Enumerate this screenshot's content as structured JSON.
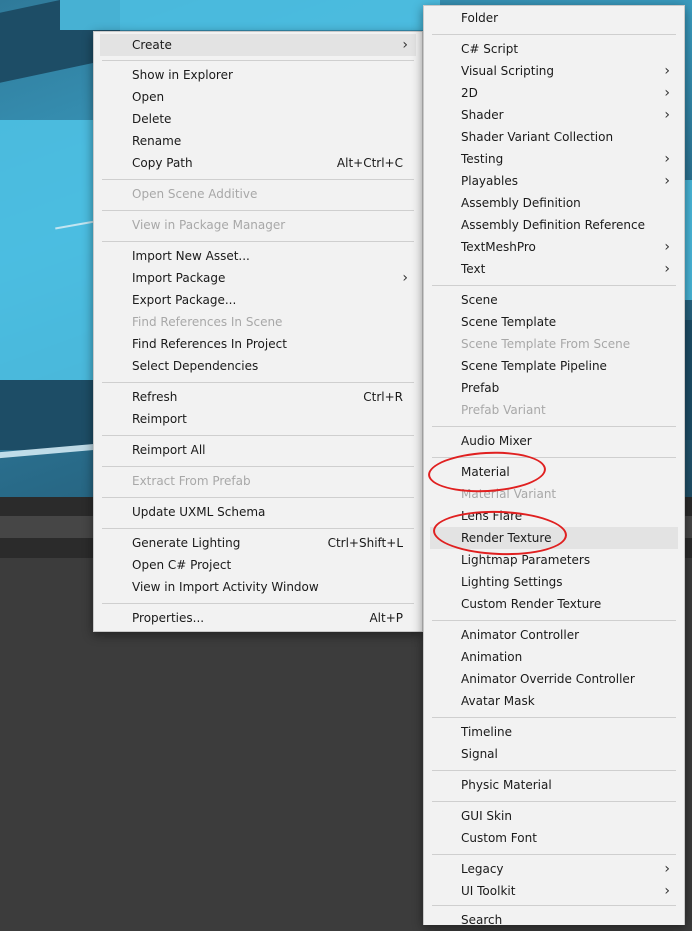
{
  "main_menu": {
    "items": [
      {
        "label": "Create",
        "shortcut": "",
        "submenu": true,
        "disabled": false,
        "highlighted": true
      },
      {
        "label": "Show in Explorer",
        "shortcut": "",
        "submenu": false,
        "disabled": false
      },
      {
        "label": "Open",
        "shortcut": "",
        "submenu": false,
        "disabled": false
      },
      {
        "label": "Delete",
        "shortcut": "",
        "submenu": false,
        "disabled": false
      },
      {
        "label": "Rename",
        "shortcut": "",
        "submenu": false,
        "disabled": false
      },
      {
        "label": "Copy Path",
        "shortcut": "Alt+Ctrl+C",
        "submenu": false,
        "disabled": false
      },
      {
        "label": "Open Scene Additive",
        "shortcut": "",
        "submenu": false,
        "disabled": true
      },
      {
        "label": "View in Package Manager",
        "shortcut": "",
        "submenu": false,
        "disabled": true
      },
      {
        "label": "Import New Asset...",
        "shortcut": "",
        "submenu": false,
        "disabled": false
      },
      {
        "label": "Import Package",
        "shortcut": "",
        "submenu": true,
        "disabled": false
      },
      {
        "label": "Export Package...",
        "shortcut": "",
        "submenu": false,
        "disabled": false
      },
      {
        "label": "Find References In Scene",
        "shortcut": "",
        "submenu": false,
        "disabled": true
      },
      {
        "label": "Find References In Project",
        "shortcut": "",
        "submenu": false,
        "disabled": false
      },
      {
        "label": "Select Dependencies",
        "shortcut": "",
        "submenu": false,
        "disabled": false
      },
      {
        "label": "Refresh",
        "shortcut": "Ctrl+R",
        "submenu": false,
        "disabled": false
      },
      {
        "label": "Reimport",
        "shortcut": "",
        "submenu": false,
        "disabled": false
      },
      {
        "label": "Reimport All",
        "shortcut": "",
        "submenu": false,
        "disabled": false
      },
      {
        "label": "Extract From Prefab",
        "shortcut": "",
        "submenu": false,
        "disabled": true
      },
      {
        "label": "Update UXML Schema",
        "shortcut": "",
        "submenu": false,
        "disabled": false
      },
      {
        "label": "Generate Lighting",
        "shortcut": "Ctrl+Shift+L",
        "submenu": false,
        "disabled": false
      },
      {
        "label": "Open C# Project",
        "shortcut": "",
        "submenu": false,
        "disabled": false
      },
      {
        "label": "View in Import Activity Window",
        "shortcut": "",
        "submenu": false,
        "disabled": false
      },
      {
        "label": "Properties...",
        "shortcut": "Alt+P",
        "submenu": false,
        "disabled": false
      }
    ]
  },
  "create_submenu": {
    "items": [
      {
        "label": "Folder",
        "submenu": false,
        "disabled": false
      },
      {
        "label": "C# Script",
        "submenu": false,
        "disabled": false
      },
      {
        "label": "Visual Scripting",
        "submenu": true,
        "disabled": false
      },
      {
        "label": "2D",
        "submenu": true,
        "disabled": false
      },
      {
        "label": "Shader",
        "submenu": true,
        "disabled": false
      },
      {
        "label": "Shader Variant Collection",
        "submenu": false,
        "disabled": false
      },
      {
        "label": "Testing",
        "submenu": true,
        "disabled": false
      },
      {
        "label": "Playables",
        "submenu": true,
        "disabled": false
      },
      {
        "label": "Assembly Definition",
        "submenu": false,
        "disabled": false
      },
      {
        "label": "Assembly Definition Reference",
        "submenu": false,
        "disabled": false
      },
      {
        "label": "TextMeshPro",
        "submenu": true,
        "disabled": false
      },
      {
        "label": "Text",
        "submenu": true,
        "disabled": false
      },
      {
        "label": "Scene",
        "submenu": false,
        "disabled": false
      },
      {
        "label": "Scene Template",
        "submenu": false,
        "disabled": false
      },
      {
        "label": "Scene Template From Scene",
        "submenu": false,
        "disabled": true
      },
      {
        "label": "Scene Template Pipeline",
        "submenu": false,
        "disabled": false
      },
      {
        "label": "Prefab",
        "submenu": false,
        "disabled": false
      },
      {
        "label": "Prefab Variant",
        "submenu": false,
        "disabled": true
      },
      {
        "label": "Audio Mixer",
        "submenu": false,
        "disabled": false
      },
      {
        "label": "Material",
        "submenu": false,
        "disabled": false,
        "annotated": true
      },
      {
        "label": "Material Variant",
        "submenu": false,
        "disabled": true
      },
      {
        "label": "Lens Flare",
        "submenu": false,
        "disabled": false
      },
      {
        "label": "Render Texture",
        "submenu": false,
        "disabled": false,
        "highlighted": true,
        "annotated": true
      },
      {
        "label": "Lightmap Parameters",
        "submenu": false,
        "disabled": false
      },
      {
        "label": "Lighting Settings",
        "submenu": false,
        "disabled": false
      },
      {
        "label": "Custom Render Texture",
        "submenu": false,
        "disabled": false
      },
      {
        "label": "Animator Controller",
        "submenu": false,
        "disabled": false
      },
      {
        "label": "Animation",
        "submenu": false,
        "disabled": false
      },
      {
        "label": "Animator Override Controller",
        "submenu": false,
        "disabled": false
      },
      {
        "label": "Avatar Mask",
        "submenu": false,
        "disabled": false
      },
      {
        "label": "Timeline",
        "submenu": false,
        "disabled": false
      },
      {
        "label": "Signal",
        "submenu": false,
        "disabled": false
      },
      {
        "label": "Physic Material",
        "submenu": false,
        "disabled": false
      },
      {
        "label": "GUI Skin",
        "submenu": false,
        "disabled": false
      },
      {
        "label": "Custom Font",
        "submenu": false,
        "disabled": false
      },
      {
        "label": "Legacy",
        "submenu": true,
        "disabled": false
      },
      {
        "label": "UI Toolkit",
        "submenu": true,
        "disabled": false
      },
      {
        "label": "Search",
        "submenu": false,
        "disabled": false
      }
    ]
  },
  "colors": {
    "menu_bg": "#f2f2f2",
    "highlight": "#e3e3e3",
    "disabled_text": "#a8a8a8",
    "annotation": "#e02020"
  },
  "icons": {
    "submenu_arrow": "chevron-right-icon"
  }
}
